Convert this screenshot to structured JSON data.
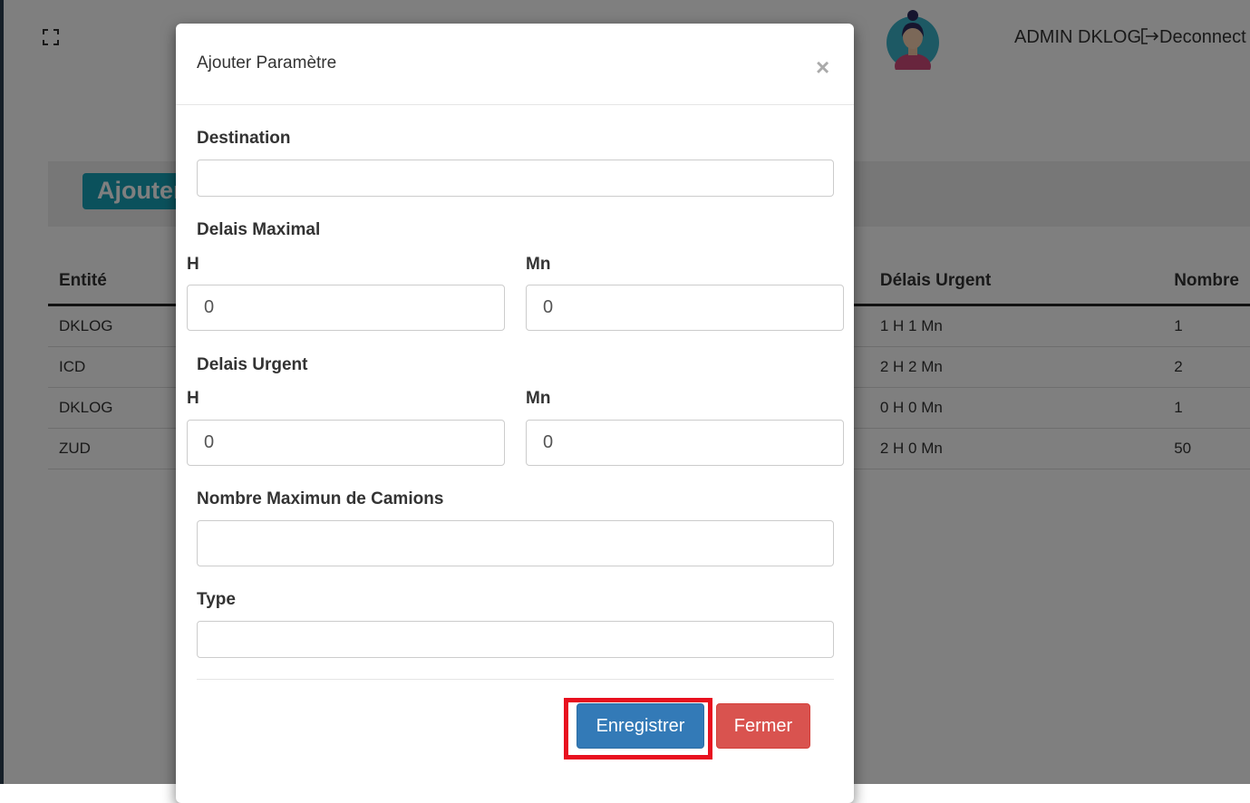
{
  "header": {
    "user_name": "ADMIN DKLOG",
    "logout_label": "Deconnect",
    "logout_icon": "logout-icon",
    "fullscreen_icon": "fullscreen-icon"
  },
  "page": {
    "add_button_label": "Ajouter"
  },
  "table": {
    "headers": {
      "entity": "Entité",
      "urgent_delay": "Délais Urgent",
      "count": "Nombre"
    },
    "rows": [
      {
        "entity": "DKLOG",
        "urgent_delay": "1 H 1 Mn",
        "count": "1"
      },
      {
        "entity": "ICD",
        "urgent_delay": "2 H 2 Mn",
        "count": "2"
      },
      {
        "entity": "DKLOG",
        "urgent_delay": "0 H 0 Mn",
        "count": "1"
      },
      {
        "entity": "ZUD",
        "urgent_delay": "2 H 0 Mn",
        "count": "50"
      }
    ]
  },
  "modal": {
    "title": "Ajouter Paramètre",
    "close_symbol": "×",
    "destination": {
      "label": "Destination",
      "value": ""
    },
    "max_delay": {
      "label": "Delais Maximal",
      "hours_label": "H",
      "hours_value": "0",
      "minutes_label": "Mn",
      "minutes_value": "0"
    },
    "urgent_delay": {
      "label": "Delais Urgent",
      "hours_label": "H",
      "hours_value": "0",
      "minutes_label": "Mn",
      "minutes_value": "0"
    },
    "max_trucks": {
      "label": "Nombre Maximun de Camions",
      "value": ""
    },
    "type": {
      "label": "Type",
      "value": ""
    },
    "save_label": "Enregistrer",
    "cancel_label": "Fermer"
  },
  "colors": {
    "save_button": "#337ab7",
    "cancel_button": "#d9534f",
    "highlight": "#e8101f",
    "add_button": "#17a2b8"
  }
}
